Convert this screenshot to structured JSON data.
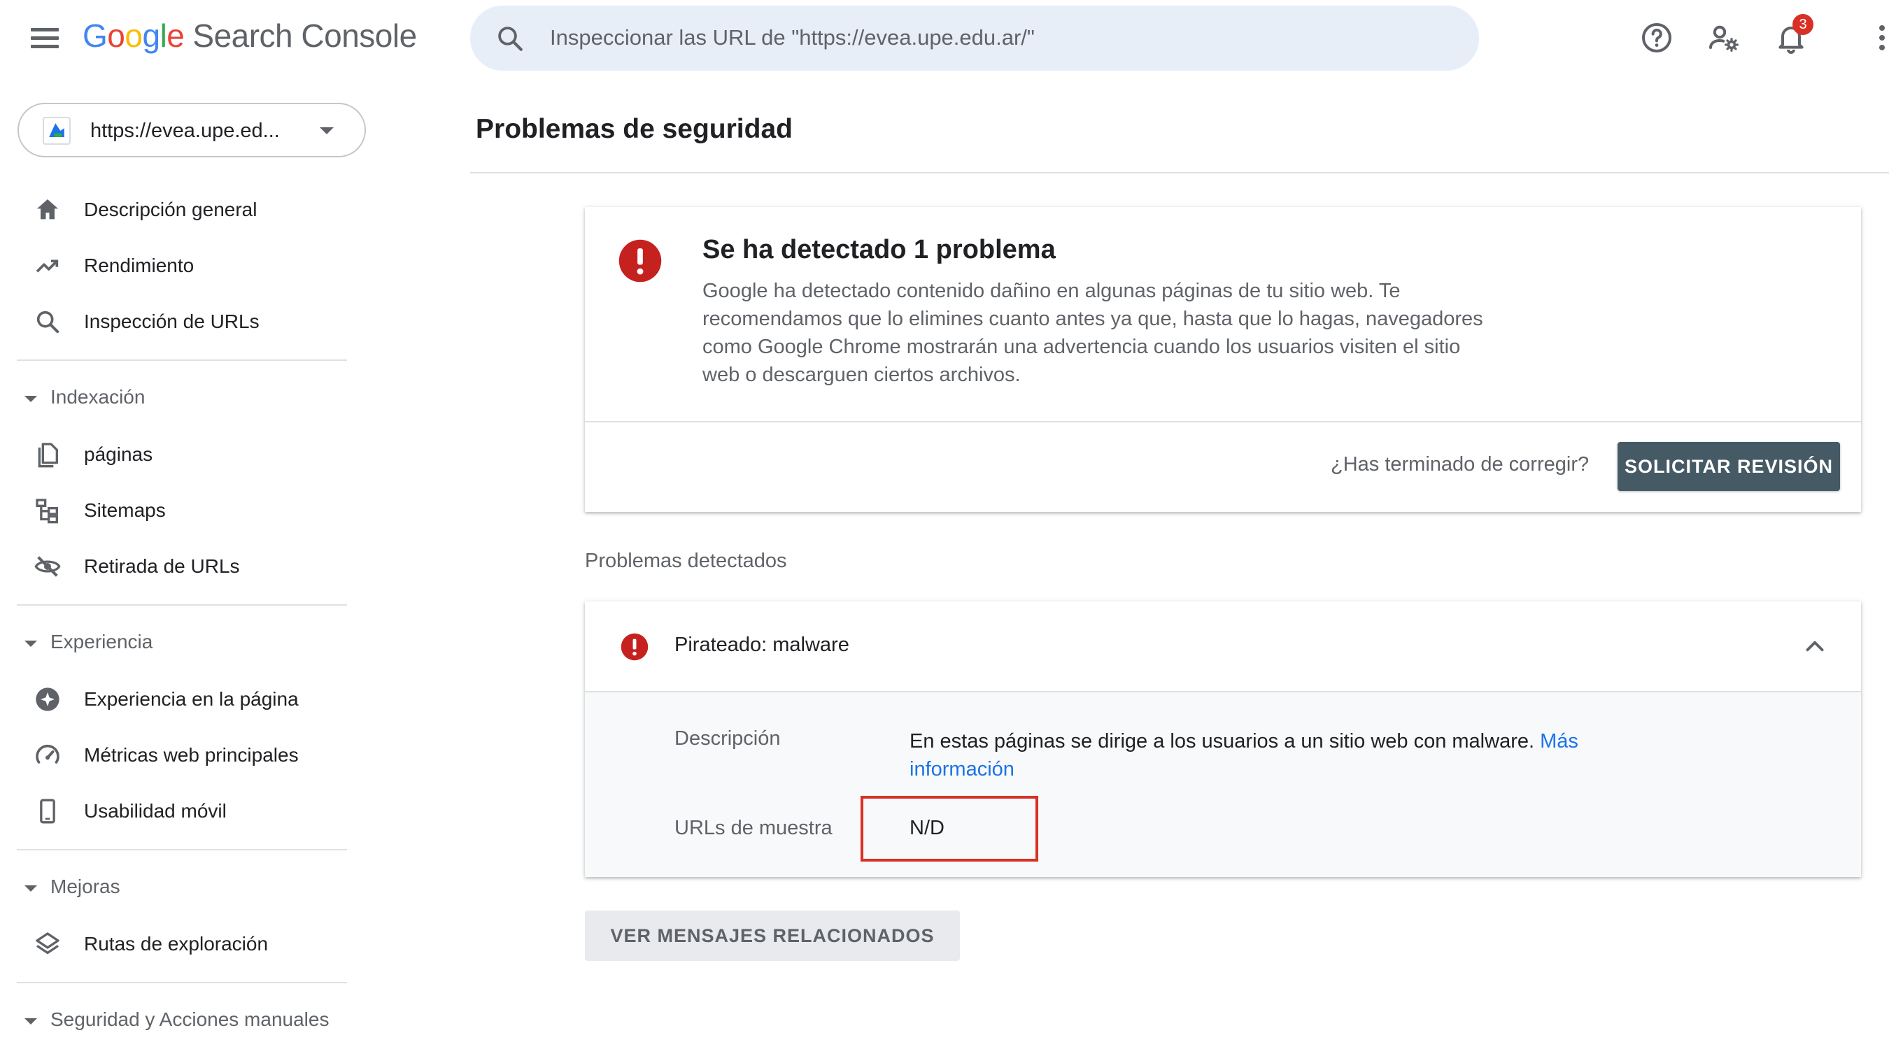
{
  "app": {
    "logo_letters": [
      "G",
      "o",
      "o",
      "g",
      "l",
      "e"
    ],
    "product_name": "Search Console",
    "brand_colors": {
      "blue": "#4285f4",
      "red": "#ea4335",
      "yellow": "#fbbc05",
      "green": "#34a853"
    }
  },
  "search": {
    "placeholder": "Inspeccionar las URL de \"https://evea.upe.edu.ar/\""
  },
  "header_icons": {
    "help": "help-icon",
    "settings": "user-settings-icon",
    "notifications": "bell-icon",
    "more": "more-vert-icon",
    "notification_count": "3"
  },
  "property": {
    "label": "https://evea.upe.ed..."
  },
  "sidebar": {
    "top_items": [
      {
        "label": "Descripción general",
        "icon": "home-icon"
      },
      {
        "label": "Rendimiento",
        "icon": "trending-icon"
      },
      {
        "label": "Inspección de URLs",
        "icon": "search-icon"
      }
    ],
    "sections": [
      {
        "label": "Indexación",
        "items": [
          {
            "label": "páginas",
            "icon": "pages-icon"
          },
          {
            "label": "Sitemaps",
            "icon": "sitemap-icon"
          },
          {
            "label": "Retirada de URLs",
            "icon": "eye-off-icon"
          }
        ]
      },
      {
        "label": "Experiencia",
        "items": [
          {
            "label": "Experiencia en la página",
            "icon": "page-experience-icon"
          },
          {
            "label": "Métricas web principales",
            "icon": "speed-icon"
          },
          {
            "label": "Usabilidad móvil",
            "icon": "mobile-icon"
          }
        ]
      },
      {
        "label": "Mejoras",
        "items": [
          {
            "label": "Rutas de exploración",
            "icon": "layers-icon"
          }
        ]
      },
      {
        "label": "Seguridad y Acciones manuales",
        "items": []
      }
    ]
  },
  "main": {
    "page_title": "Problemas de seguridad",
    "summary": {
      "title": "Se ha detectado 1 problema",
      "body": "Google ha detectado contenido dañino en algunas páginas de tu sitio web. Te recomendamos que lo elimines cuanto antes ya que, hasta que lo hagas, navegadores como Google Chrome mostrarán una advertencia cuando los usuarios visiten el sitio web o descarguen ciertos archivos.",
      "finish_question": "¿Has terminado de corregir?",
      "review_button": "SOLICITAR REVISIÓN"
    },
    "detected_label": "Problemas detectados",
    "issue": {
      "title": "Pirateado: malware",
      "description_label": "Descripción",
      "description_text": "En estas páginas se dirige a los usuarios a un sitio web con malware.",
      "more_info_link": "Más información",
      "sample_urls_label": "URLs de muestra",
      "sample_urls_value": "N/D"
    },
    "related_button": "VER MENSAJES RELACIONADOS"
  },
  "colors": {
    "error": "#d93025",
    "primary_button": "#455a64",
    "link": "#1a73e8",
    "search_bg": "#e8eef8"
  }
}
